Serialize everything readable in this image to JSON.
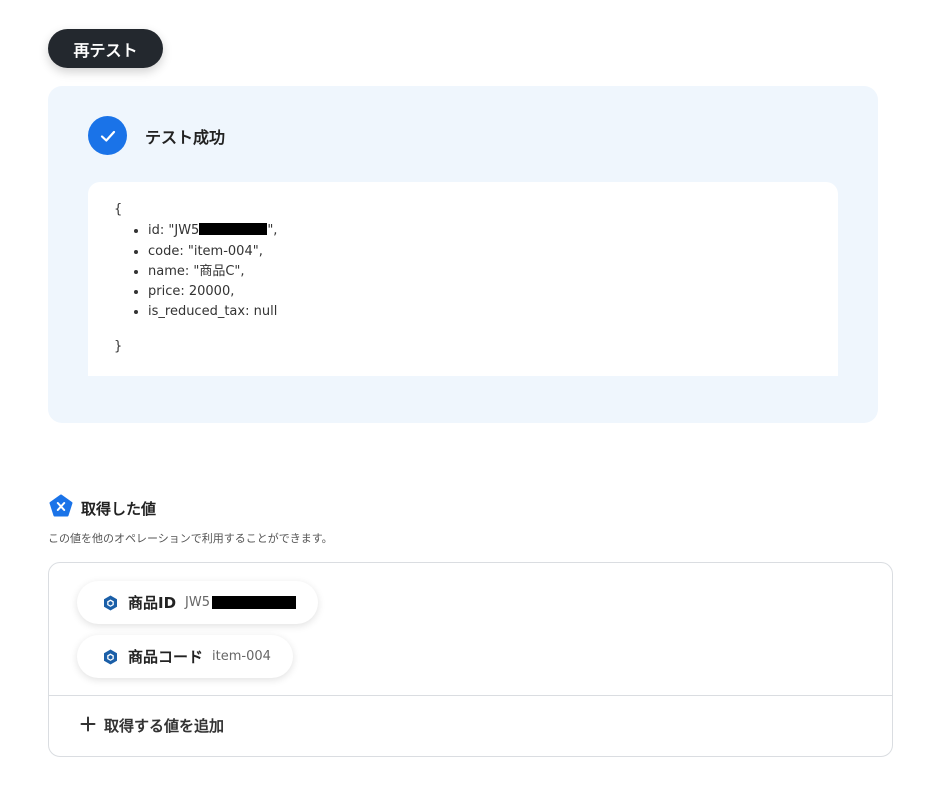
{
  "retest": {
    "label": "再テスト"
  },
  "result": {
    "title": "テスト成功",
    "json_open": "{",
    "json_close": "}",
    "fields": [
      {
        "prefix": "id: \"JW5",
        "redacted": true,
        "suffix": "\","
      },
      {
        "text": "code: \"item-004\","
      },
      {
        "text": "name: \"商品C\","
      },
      {
        "text": "price: 20000,"
      },
      {
        "text": "is_reduced_tax: null"
      }
    ]
  },
  "acquired": {
    "title": "取得した値",
    "description": "この値を他のオペレーションで利用することができます。",
    "items": [
      {
        "label": "商品ID",
        "value": "JW5"
      },
      {
        "label": "商品コード",
        "value": "item-004"
      }
    ],
    "add_label": "取得する値を追加"
  },
  "colors": {
    "accent": "#1a73e8",
    "dark_button": "#23282e",
    "panel_bg": "#eff6fd",
    "chip_icon": "#1b5fa8"
  }
}
